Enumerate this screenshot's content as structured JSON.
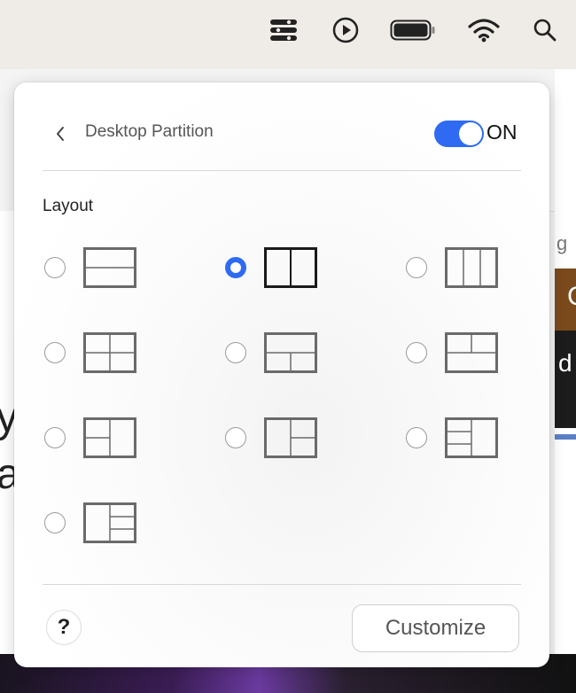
{
  "menubar": {
    "icons": [
      "control-center-icon",
      "play-icon",
      "battery-icon",
      "wifi-icon",
      "search-icon"
    ]
  },
  "background": {
    "left_letters": [
      "y",
      "a"
    ],
    "right_letter_top": "g",
    "right_letter_mid": "d",
    "right_letter_brown": "C"
  },
  "panel": {
    "title": "Desktop Partition",
    "toggle_label": "ON",
    "toggle_on": true,
    "accent_color": "#2f6bf2",
    "section_label": "Layout",
    "layouts": [
      {
        "name": "two-rows",
        "selected": false
      },
      {
        "name": "two-columns",
        "selected": true
      },
      {
        "name": "three-columns",
        "selected": false
      },
      {
        "name": "four-grid",
        "selected": false
      },
      {
        "name": "top-one-bottom-two",
        "selected": false
      },
      {
        "name": "top-two-bottom-one",
        "selected": false
      },
      {
        "name": "left-two-right-one",
        "selected": false
      },
      {
        "name": "left-one-right-two",
        "selected": false
      },
      {
        "name": "left-three-right-one",
        "selected": false
      },
      {
        "name": "left-one-right-three",
        "selected": false
      }
    ],
    "help_label": "?",
    "customize_label": "Customize"
  }
}
